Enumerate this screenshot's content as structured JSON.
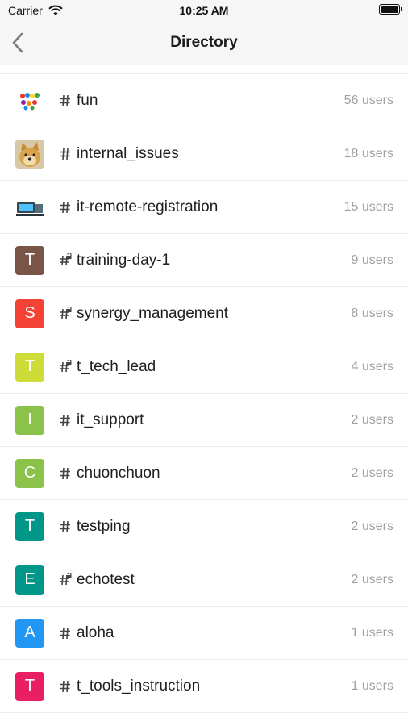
{
  "status": {
    "carrier": "Carrier",
    "time": "10:25 AM"
  },
  "nav": {
    "title": "Directory"
  },
  "icons": {
    "back": "chevron-left-icon",
    "wifi": "wifi-icon",
    "battery": "battery-icon",
    "hash": "hash-icon",
    "lock_hash": "private-hash-icon"
  },
  "channels": [
    {
      "name": "fun",
      "count": "56 users",
      "avatar_type": "image",
      "avatar_icon": "balloons-image-icon",
      "private": false
    },
    {
      "name": "internal_issues",
      "count": "18 users",
      "avatar_type": "image",
      "avatar_icon": "doge-image-icon",
      "private": false
    },
    {
      "name": "it-remote-registration",
      "count": "15 users",
      "avatar_type": "image",
      "avatar_icon": "computer-image-icon",
      "private": false
    },
    {
      "name": "training-day-1",
      "count": "9 users",
      "avatar_type": "letter",
      "letter": "T",
      "color": "#795548",
      "private": true
    },
    {
      "name": "synergy_management",
      "count": "8 users",
      "avatar_type": "letter",
      "letter": "S",
      "color": "#f44336",
      "private": true
    },
    {
      "name": "t_tech_lead",
      "count": "4 users",
      "avatar_type": "letter",
      "letter": "T",
      "color": "#cddc39",
      "private": true
    },
    {
      "name": "it_support",
      "count": "2 users",
      "avatar_type": "letter",
      "letter": "I",
      "color": "#8bc34a",
      "private": false
    },
    {
      "name": "chuonchuon",
      "count": "2 users",
      "avatar_type": "letter",
      "letter": "C",
      "color": "#8bc34a",
      "private": false
    },
    {
      "name": "testping",
      "count": "2 users",
      "avatar_type": "letter",
      "letter": "T",
      "color": "#009688",
      "private": false
    },
    {
      "name": "echotest",
      "count": "2 users",
      "avatar_type": "letter",
      "letter": "E",
      "color": "#009688",
      "private": true
    },
    {
      "name": "aloha",
      "count": "1 users",
      "avatar_type": "letter",
      "letter": "A",
      "color": "#2196f3",
      "private": false
    },
    {
      "name": "t_tools_instruction",
      "count": "1 users",
      "avatar_type": "letter",
      "letter": "T",
      "color": "#e91e63",
      "private": false
    }
  ]
}
